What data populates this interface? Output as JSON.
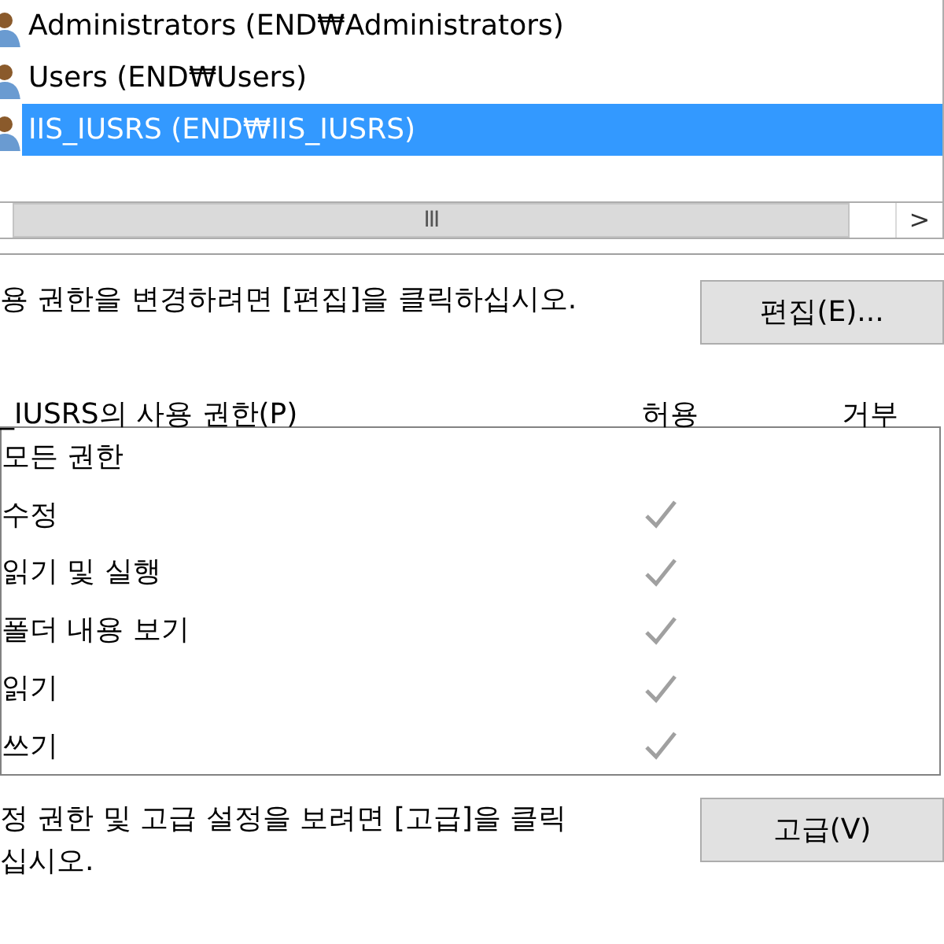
{
  "principals": [
    {
      "label": "Administrators (END₩Administrators)",
      "selected": false
    },
    {
      "label": "Users (END₩Users)",
      "selected": false
    },
    {
      "label": "IIS_IUSRS (END₩IIS_IUSRS)",
      "selected": true
    }
  ],
  "scroll_thumb_grip": "III",
  "scroll_right_arrow": ">",
  "edit_hint": "용 권한을 변경하려면 [편집]을 클릭하십시오.",
  "edit_button": "편집(E)...",
  "permissions_header": {
    "title": "_IUSRS의 사용 권한(P)",
    "allow": "허용",
    "deny": "거부"
  },
  "permissions": [
    {
      "name": "모든 권한",
      "allow": false,
      "deny": false
    },
    {
      "name": "수정",
      "allow": true,
      "deny": false
    },
    {
      "name": "읽기 및 실행",
      "allow": true,
      "deny": false
    },
    {
      "name": "폴더 내용 보기",
      "allow": true,
      "deny": false
    },
    {
      "name": "읽기",
      "allow": true,
      "deny": false
    },
    {
      "name": "쓰기",
      "allow": true,
      "deny": false
    }
  ],
  "advanced_hint": "정 권한 및 고급 설정을 보려면 [고급]을 클릭 십시오.",
  "advanced_button": "고급(V)"
}
